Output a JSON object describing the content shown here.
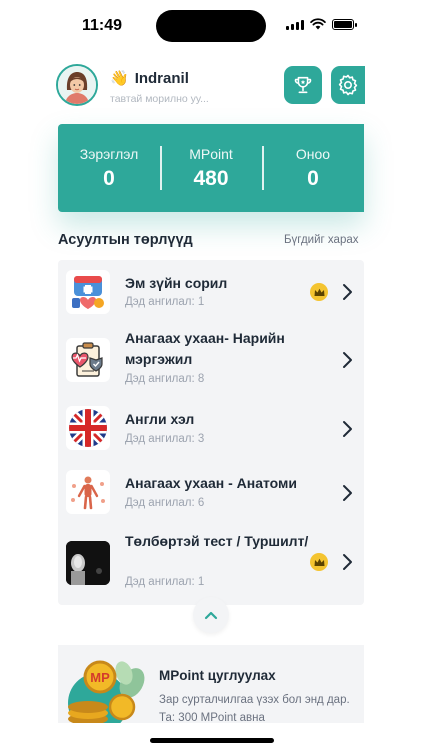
{
  "status": {
    "time": "11:49"
  },
  "header": {
    "wave": "👋",
    "name": "Indranil",
    "subtitle": "тавтай морилно уу..."
  },
  "stats": [
    {
      "label": "Зэрэглэл",
      "value": "0"
    },
    {
      "label": "MPoint",
      "value": "480"
    },
    {
      "label": "Оноо",
      "value": "0"
    }
  ],
  "section": {
    "title": "Асуултын төрлүүд",
    "see_all": "Бүгдийг харах"
  },
  "categories": [
    {
      "title": "Эм зүйн сорил",
      "sub": "Дэд ангилал: 1",
      "premium": true,
      "icon": "medicine-icon"
    },
    {
      "title": "Анагаах ухаан- Нарийн мэргэжил",
      "sub": "Дэд ангилал: 8",
      "premium": false,
      "icon": "medical-clipboard-icon"
    },
    {
      "title": "Англи хэл",
      "sub": "Дэд ангилал: 3",
      "premium": false,
      "icon": "uk-flag-icon"
    },
    {
      "title": "Анагаах ухаан - Анатоми",
      "sub": "Дэд ангилал: 6",
      "premium": false,
      "icon": "anatomy-icon"
    },
    {
      "title": "Төлбөртэй тест / Туршилт/",
      "sub": "Дэд ангилал: 1",
      "premium": true,
      "icon": "robot-photo-icon"
    }
  ],
  "promo": {
    "title": "MPoint цуглуулах",
    "text": "Зар сурталчилгаа үзэх бол энд дар. Та: 300 MPoint авна",
    "coin_label": "MP"
  },
  "colors": {
    "accent": "#2ea89a",
    "premium": "#f4c430"
  }
}
